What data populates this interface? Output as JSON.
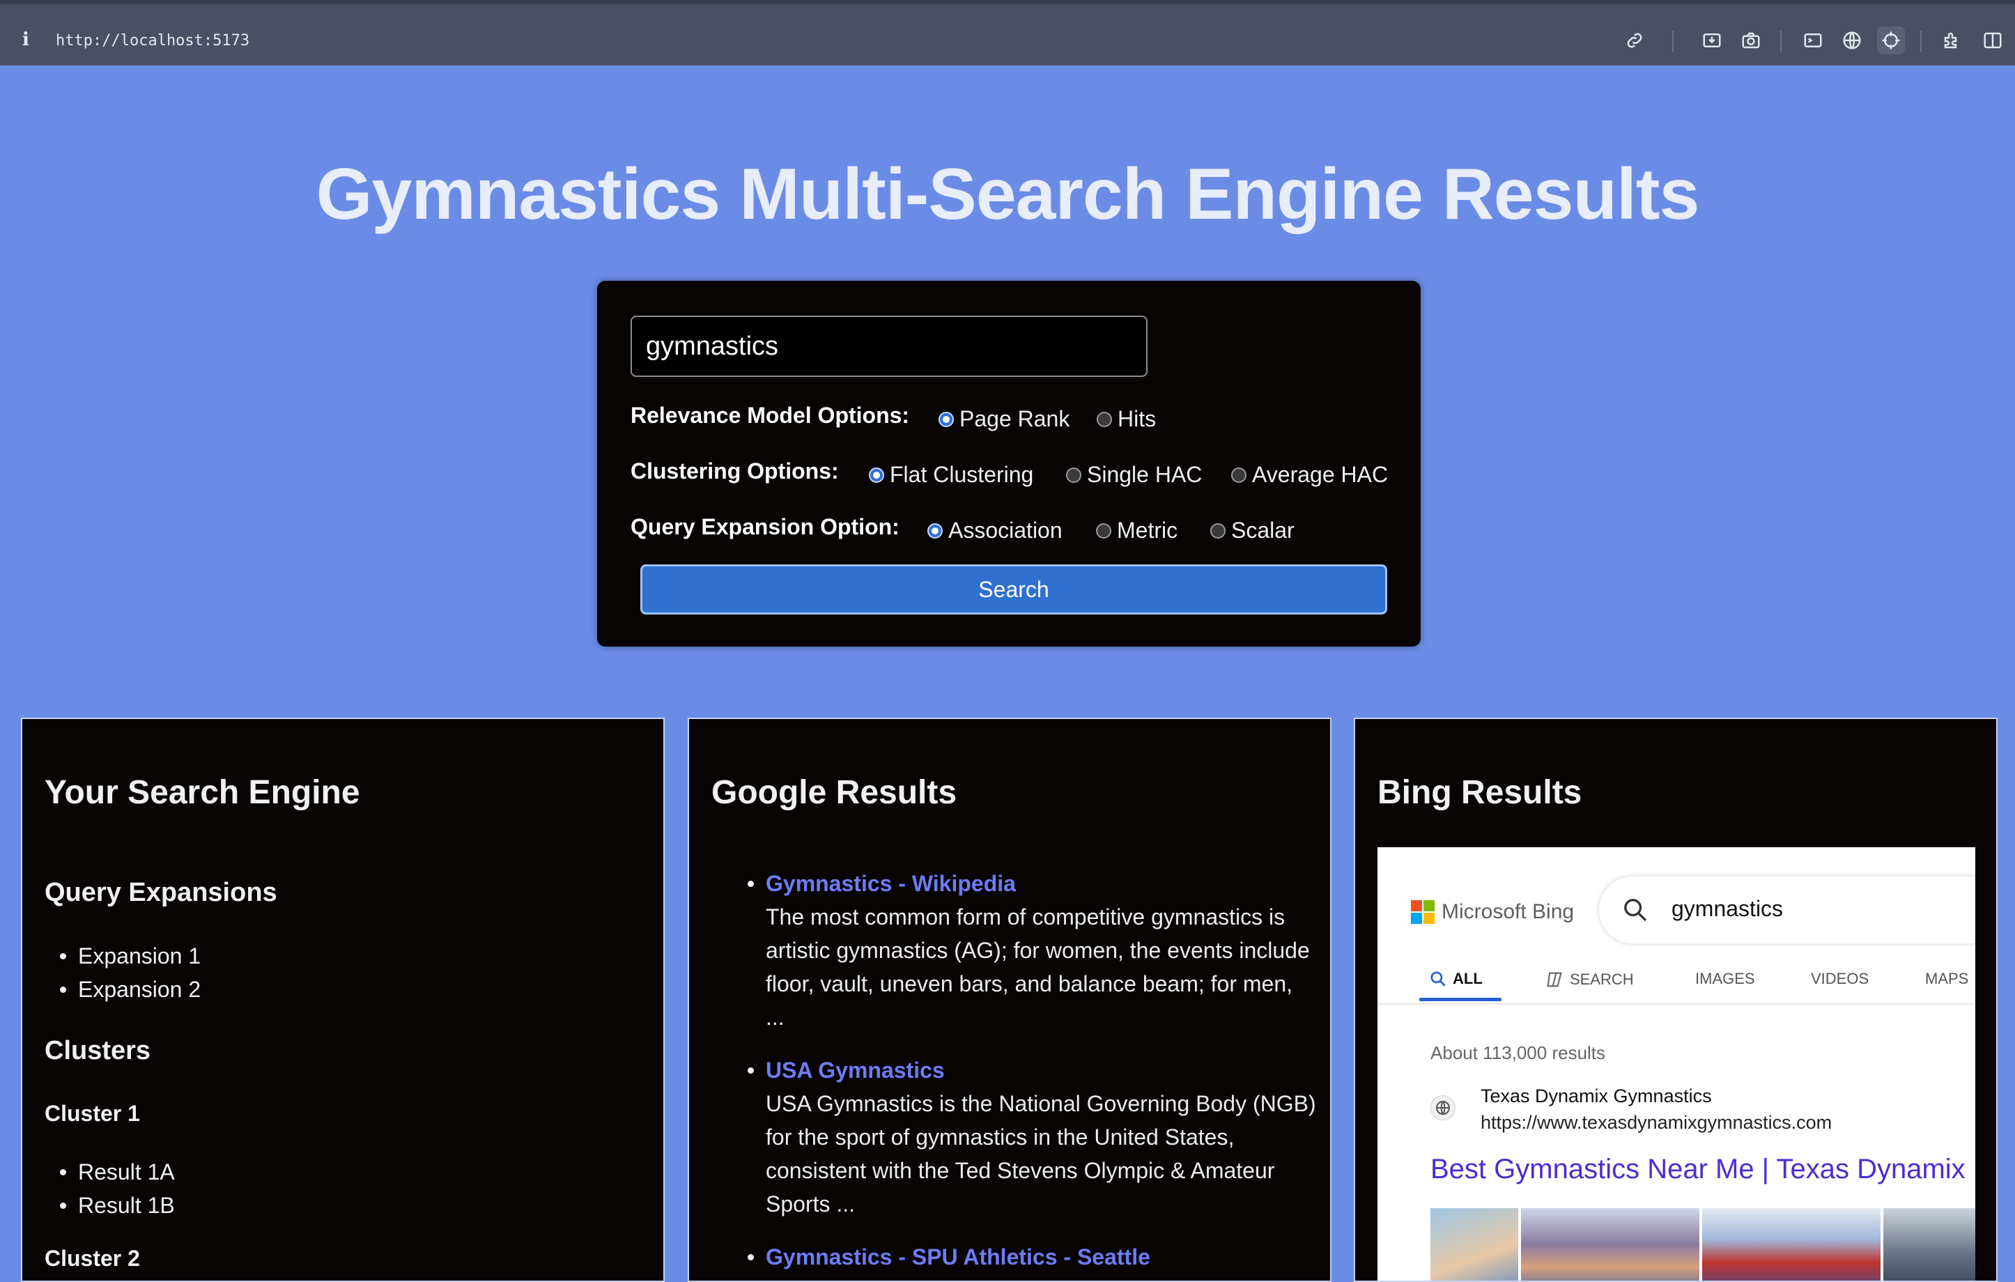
{
  "browser": {
    "url": "http://localhost:5173",
    "info_icon": "i",
    "toolbar_icons": [
      "link-icon",
      "screenshot-area-icon",
      "camera-icon",
      "terminal-icon",
      "globe-icon",
      "crosshair-icon",
      "extensions-icon",
      "sidebar-icon"
    ]
  },
  "header": {
    "title": "Gymnastics Multi-Search Engine Results"
  },
  "search": {
    "query": "gymnastics",
    "button_label": "Search",
    "relevance": {
      "label": "Relevance Model Options:",
      "options": [
        "Page Rank",
        "Hits"
      ],
      "selected": "Page Rank"
    },
    "clustering": {
      "label": "Clustering Options:",
      "options": [
        "Flat Clustering",
        "Single HAC",
        "Average HAC"
      ],
      "selected": "Flat Clustering"
    },
    "expansion": {
      "label": "Query Expansion Option:",
      "options": [
        "Association",
        "Metric",
        "Scalar"
      ],
      "selected": "Association"
    }
  },
  "your_engine": {
    "title": "Your Search Engine",
    "query_expansions_heading": "Query Expansions",
    "expansions": [
      "Expansion 1",
      "Expansion 2"
    ],
    "clusters_heading": "Clusters",
    "clusters": [
      {
        "name": "Cluster 1",
        "results": [
          "Result 1A",
          "Result 1B"
        ]
      },
      {
        "name": "Cluster 2",
        "results": []
      }
    ]
  },
  "google": {
    "title": "Google Results",
    "results": [
      {
        "title": "Gymnastics - Wikipedia",
        "snippet": "The most common form of competitive gymnastics is artistic gymnastics (AG); for women, the events include floor, vault, uneven bars, and balance beam; for men, ..."
      },
      {
        "title": "USA Gymnastics",
        "snippet": "USA Gymnastics is the National Governing Body (NGB) for the sport of gymnastics in the United States, consistent with the Ted Stevens Olympic & Amateur Sports ..."
      },
      {
        "title": "Gymnastics - SPU Athletics - Seattle",
        "snippet": ""
      }
    ]
  },
  "bing": {
    "title": "Bing Results",
    "brand": "Microsoft Bing",
    "query": "gymnastics",
    "tabs": [
      "ALL",
      "SEARCH",
      "IMAGES",
      "VIDEOS",
      "MAPS"
    ],
    "active_tab": "ALL",
    "result_count": "About 113,000 results",
    "first_result": {
      "site_name": "Texas Dynamix Gymnastics",
      "site_url": "https://www.texasdynamixgymnastics.com",
      "title": "Best Gymnastics Near Me | Texas Dynamix"
    },
    "colors": {
      "ms_red": "#f25022",
      "ms_green": "#7fba00",
      "ms_blue": "#00a4ef",
      "ms_yellow": "#ffb900",
      "link": "#4e2bd4",
      "accent": "#2461d8"
    }
  },
  "colors": {
    "page_bg": "#6b8ce6",
    "panel_bg": "#080404",
    "link": "#6e7cf5",
    "button": "#3070cf"
  }
}
